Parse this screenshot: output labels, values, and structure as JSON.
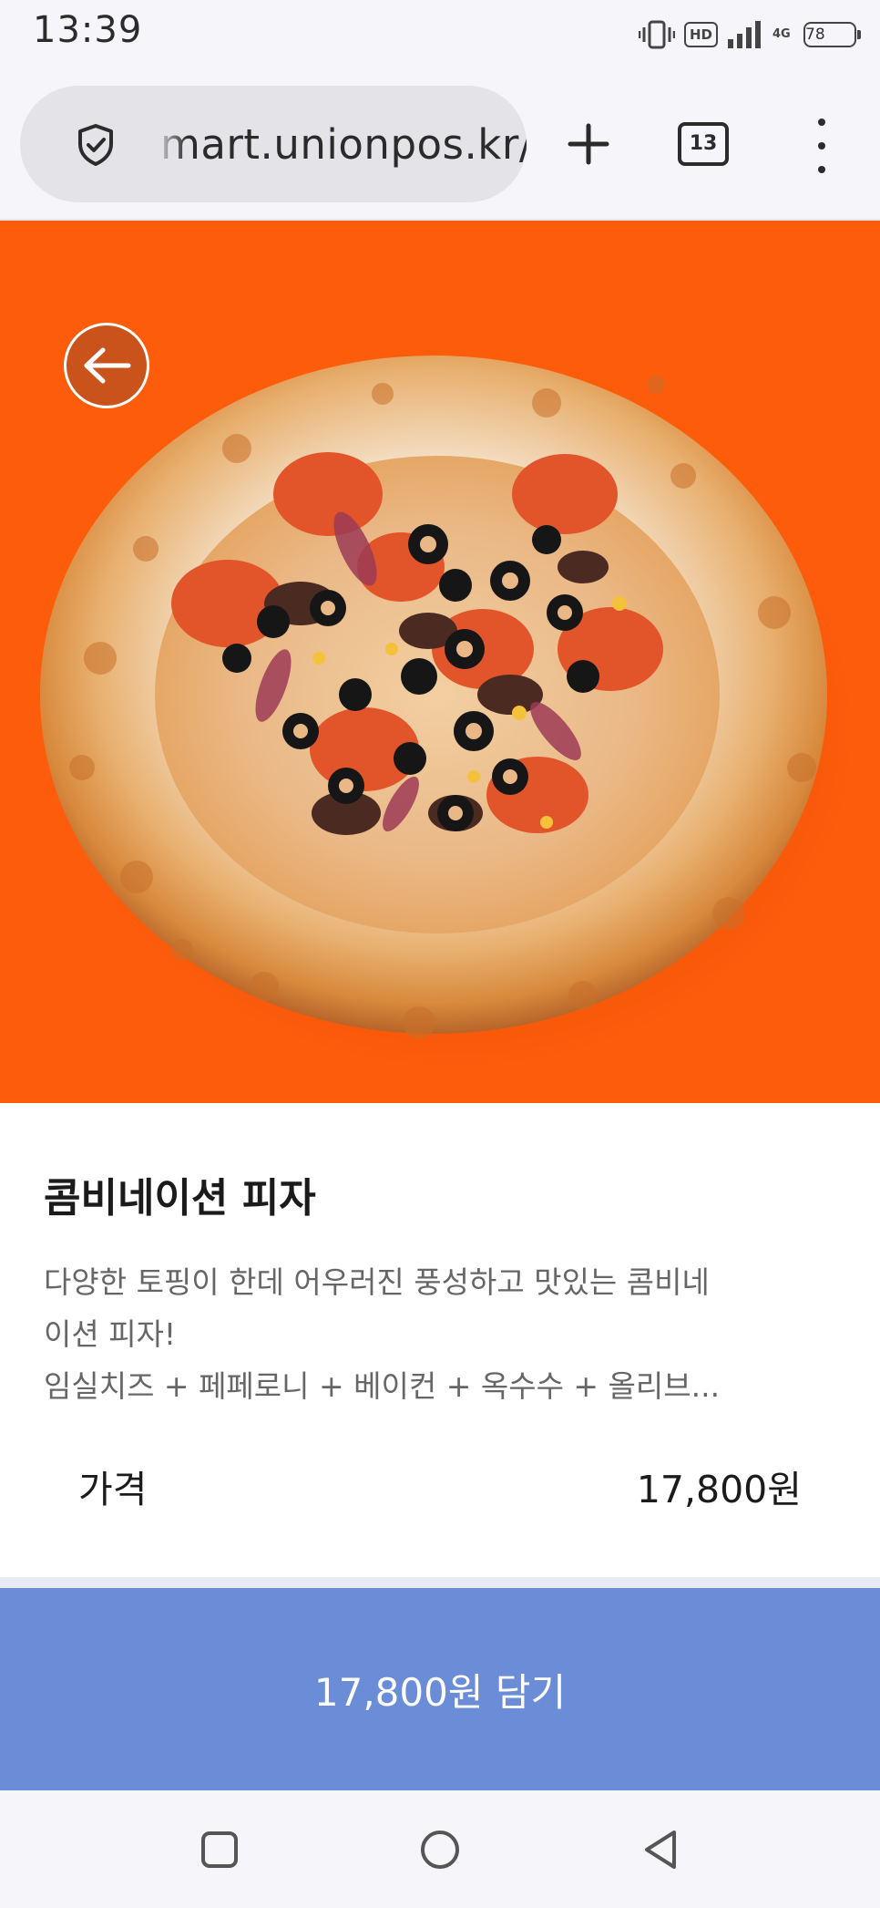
{
  "status_bar": {
    "time": "13:39",
    "hd": "HD",
    "network": "4G",
    "battery": "78"
  },
  "browser": {
    "url": "mart.unionpos.kr/",
    "tab_count": "13",
    "icons": [
      "shield-check-icon",
      "plus-icon",
      "tabs-icon",
      "more-vert-icon"
    ]
  },
  "product": {
    "image": "combination-pizza-photo",
    "name": "콤비네이션 피자",
    "description_lines": [
      "다양한 토핑이 한데 어우러진 풍성하고 맛있는 콤비네",
      "이션 피자!",
      "임실치즈 + 페페로니 + 베이컨 + 옥수수 + 올리브..."
    ],
    "price_label": "가격",
    "price_value": "17,800원"
  },
  "cart": {
    "button_label": "17,800원 담기"
  },
  "colors": {
    "hero_background": "#fd5c0b",
    "cart_button": "#6b8dd8",
    "chrome": "#f6f6fa"
  },
  "system_nav": {
    "icons": [
      "recent-apps-icon",
      "home-icon",
      "back-icon"
    ]
  }
}
